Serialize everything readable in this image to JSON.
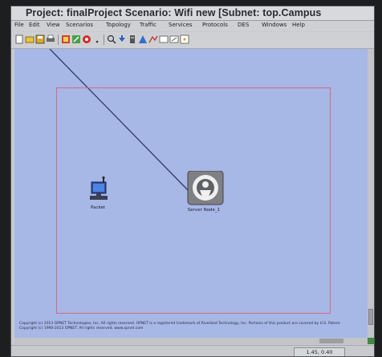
{
  "window": {
    "title": "Project: finalProject Scenario: Wifi new  [Subnet: top.Campus"
  },
  "menubar": {
    "items": [
      "File",
      "Edit",
      "View",
      "Scenarios",
      "Topology",
      "Traffic",
      "Services",
      "Protocols",
      "DES",
      "Windows",
      "Help"
    ]
  },
  "toolbar": {
    "icons": [
      "new-icon",
      "open-icon",
      "save-icon",
      "print-icon",
      "object-palette-icon",
      "link-icon",
      "failure-icon",
      "recover-icon",
      "zoom-icon",
      "zoom-out-icon",
      "configure-icon",
      "run-icon",
      "view-results-icon",
      "web-report-icon",
      "annotation-icon",
      "help-icon"
    ]
  },
  "canvas": {
    "nodes": [
      {
        "label": "Packet"
      },
      {
        "label": "Server Node_1"
      }
    ],
    "copyright_line1": "Copyright (c) 2013 OPNET Technologies, Inc. All rights reserved. OPNET is a registered trademark of Riverbed Technology, Inc. Portions of this product are covered by U.S. Patent",
    "copyright_line2": "Copyright (c) 1990-2013 OPNET. All rights reserved. www.opnet.com"
  },
  "statusbar": {
    "coordinates": "1.45, 0.40"
  },
  "colors": {
    "canvas_bg": "#a7b7e6",
    "subnet_border": "#d46a86",
    "link_line": "#303a6a"
  }
}
